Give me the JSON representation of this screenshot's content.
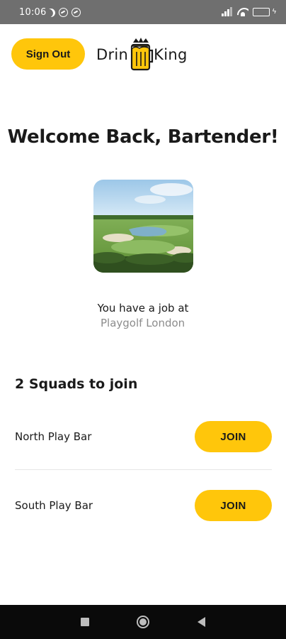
{
  "status_bar": {
    "time": "10:06",
    "icons": [
      "moon-icon",
      "sync-icon",
      "sync-icon",
      "signal-icon",
      "wifi-icon",
      "battery-icon",
      "charging-icon"
    ]
  },
  "header": {
    "sign_out_label": "Sign Out",
    "logo_left": "Drin",
    "logo_right": "King",
    "logo_icon": "beer-mug-crown-icon"
  },
  "main": {
    "welcome": "Welcome Back, Bartender!",
    "job_prefix": "You have a job at",
    "job_venue": "Playgolf London",
    "squads_title": "2 Squads to join",
    "squads": [
      {
        "name": "North Play Bar",
        "action_label": "JOIN"
      },
      {
        "name": "South Play Bar",
        "action_label": "JOIN"
      }
    ]
  },
  "nav_bar": {
    "buttons": [
      "recents-icon",
      "home-icon",
      "back-icon"
    ]
  },
  "colors": {
    "accent": "#ffc60b",
    "muted_text": "#8c8c8c",
    "status_bar": "#6f6f6f",
    "nav_bar": "#0a0a0a"
  }
}
